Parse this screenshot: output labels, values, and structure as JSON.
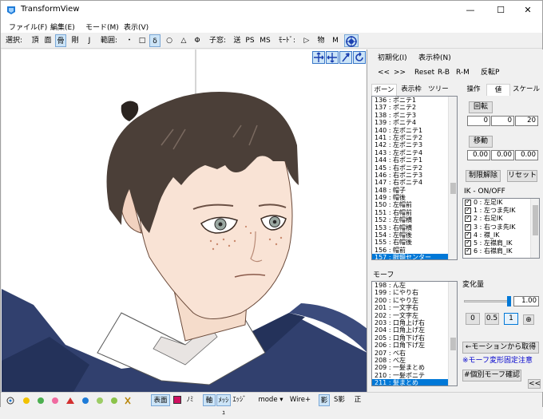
{
  "window": {
    "title": "TransformView",
    "min": "—",
    "max": "☐",
    "close": "✕"
  },
  "menu": [
    "ファイル(F)",
    "編集(E)",
    "モード(M)",
    "表示(V)"
  ],
  "toolbar": {
    "select_label": "選択:",
    "select_items": [
      "頂",
      "面",
      "骨",
      "剛",
      "J"
    ],
    "range_label": "範囲:",
    "range_items": [
      "・",
      "□",
      "δ",
      "○",
      "△",
      "Φ"
    ],
    "child_label": "子窓:",
    "child_items": [
      "送",
      "PS",
      "MS"
    ],
    "mode_label": "ﾓｰﾄﾞ:",
    "mode_items": [
      "▷",
      "物",
      "M"
    ]
  },
  "panel": {
    "init_label": "初期化(I)",
    "show_frame_label": "表示枠(N)",
    "nav": [
      "<<",
      ">>",
      "Reset",
      "R-B",
      "R-M",
      "反転P"
    ],
    "bone_tabs": [
      "ボーン",
      "表示枠",
      "ツリー"
    ],
    "bone_list": [
      "136 : ポニテ1",
      "137 : ポニテ2",
      "138 : ポニテ3",
      "139 : ポニテ4",
      "140 : 左ポニテ1",
      "141 : 左ポニテ2",
      "142 : 左ポニテ3",
      "143 : 左ポニテ4",
      "144 : 右ポニテ1",
      "145 : 右ポニテ2",
      "146 : 右ポニテ3",
      "147 : 右ポニテ4",
      "148 : 帽子",
      "149 : 帽後",
      "150 : 左帽前",
      "151 : 右帽前",
      "152 : 左帽横",
      "153 : 右帽横",
      "154 : 左帽後",
      "155 : 右帽後",
      "156 : 帽前",
      "157 : 眼鏡センター"
    ],
    "bone_selected": 21,
    "op_tabs": [
      "操作",
      "値",
      "スケール"
    ],
    "rotate_label": "回転",
    "rotate": [
      "0",
      "0",
      "20"
    ],
    "move_label": "移動",
    "move": [
      "0.00",
      "0.00",
      "0.00"
    ],
    "limit_release": "制限解除",
    "reset": "リセット",
    "ik_title": "IK - ON/OFF",
    "ik_list": [
      "0 : 左足IK",
      "1 : 左つま先IK",
      "2 : 右足IK",
      "3 : 右つま先IK",
      "4 : 襟_IK",
      "5 : 左襟肩_IK",
      "6 : 右襟肩_IK"
    ],
    "morph_label": "モーフ",
    "morph_list": [
      "198 : ん左",
      "199 : にやり右",
      "200 : にやり左",
      "201 : 一文字右",
      "202 : 一文字左",
      "203 : 口角上げ右",
      "204 : 口角上げ左",
      "205 : 口角下げ右",
      "206 : 口角下げ左",
      "207 : べ右",
      "208 : べ左",
      "209 : 一髪まとめ",
      "210 : 一髪ポニテ",
      "211 : 髪まとめ"
    ],
    "morph_selected": 13,
    "change_label": "変化量",
    "change_value": "1.00",
    "slider_level": 1.0,
    "presets": [
      "0",
      "0.5",
      "1"
    ],
    "pin": "⊕",
    "from_motion": "←モーションから取得",
    "warn": "※モーフ変形固定注意",
    "confirm": "#個別モーフ確認",
    "collapse": "<<"
  },
  "statusbar": {
    "items": [
      "表面",
      "ﾉﾐ",
      "軸",
      "ﾒｯｼｭ",
      "ｴｯｼﾞ",
      "mode ▾",
      "Wire+",
      "影",
      "S影",
      "正"
    ]
  }
}
